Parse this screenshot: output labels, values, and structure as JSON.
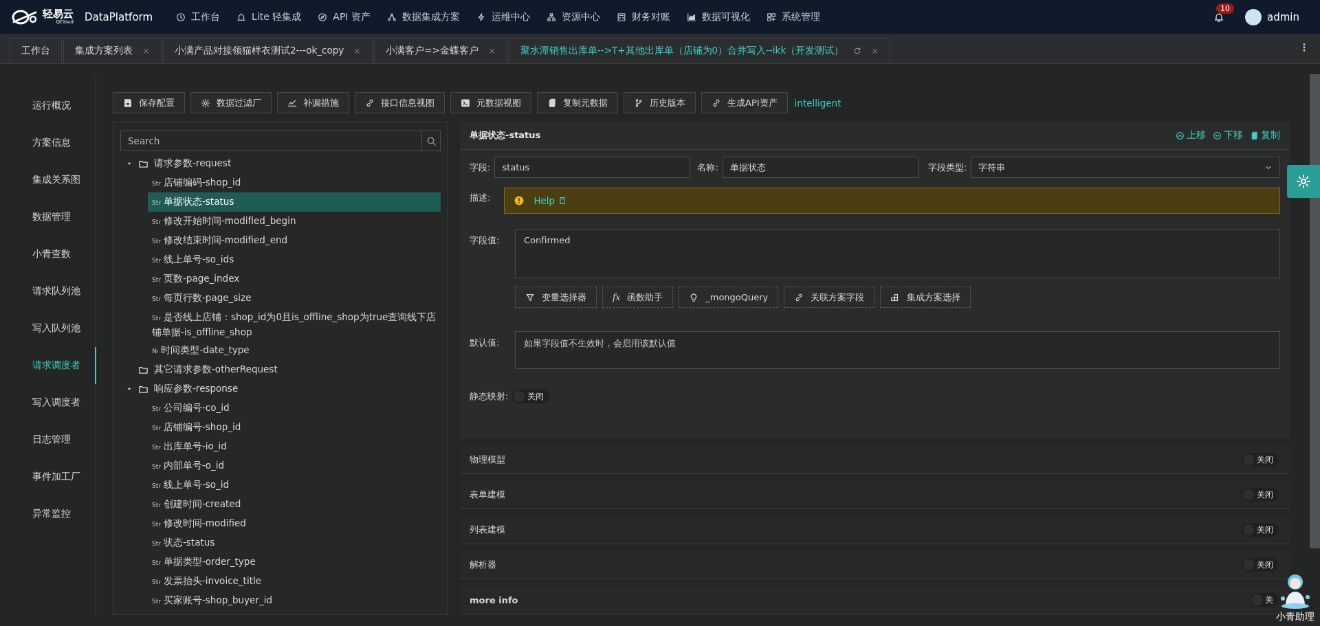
{
  "nav": {
    "brand": "轻易云",
    "brand_sub": "QCloud",
    "product": "DataPlatform",
    "menu": [
      {
        "label": "工作台"
      },
      {
        "label": "Lite 轻集成"
      },
      {
        "label": "API 资产"
      },
      {
        "label": "数据集成方案"
      },
      {
        "label": "运维中心"
      },
      {
        "label": "资源中心"
      },
      {
        "label": "财务对账"
      },
      {
        "label": "数据可视化"
      },
      {
        "label": "系统管理"
      }
    ],
    "notifications": "10",
    "user": "admin"
  },
  "tabs": [
    {
      "label": "工作台",
      "selected": false,
      "closable": false
    },
    {
      "label": "集成方案列表",
      "selected": false,
      "closable": true
    },
    {
      "label": "小满产品对接领猫样衣测试2---ok_copy",
      "selected": false,
      "closable": true
    },
    {
      "label": "小满客户=>金蝶客户",
      "selected": false,
      "closable": true
    },
    {
      "label": "聚水潭销售出库单-->T+其他出库单（店铺为0）合并写入--ikk（开发测试）",
      "selected": true,
      "closable": true
    }
  ],
  "sidebar": {
    "items": [
      {
        "label": "运行概况",
        "selected": false
      },
      {
        "label": "方案信息",
        "selected": false
      },
      {
        "label": "集成关系图",
        "selected": false
      },
      {
        "label": "数据管理",
        "selected": false
      },
      {
        "label": "小青查数",
        "selected": false
      },
      {
        "label": "请求队列池",
        "selected": false
      },
      {
        "label": "写入队列池",
        "selected": false
      },
      {
        "label": "请求调度者",
        "selected": true
      },
      {
        "label": "写入调度者",
        "selected": false
      },
      {
        "label": "日志管理",
        "selected": false
      },
      {
        "label": "事件加工厂",
        "selected": false
      },
      {
        "label": "异常监控",
        "selected": false
      }
    ]
  },
  "toolbar": {
    "buttons": [
      {
        "label": "保存配置"
      },
      {
        "label": "数据过滤厂"
      },
      {
        "label": "补漏措施"
      },
      {
        "label": "接口信息视图"
      },
      {
        "label": "元数据视图"
      },
      {
        "label": "复制元数据"
      },
      {
        "label": "历史版本"
      },
      {
        "label": "生成API资产"
      }
    ],
    "link": "intelligent"
  },
  "tree": {
    "search": {
      "placeholder": "Search"
    },
    "nodes": [
      {
        "kind": "folder",
        "label": "请求参数-request",
        "expanded": true,
        "children": [
          {
            "kind": "field",
            "type_tag": "Str",
            "label": "店铺编码-shop_id",
            "selected": false
          },
          {
            "kind": "field",
            "type_tag": "Str",
            "label": "单据状态-status",
            "selected": true
          },
          {
            "kind": "field",
            "type_tag": "Str",
            "label": "修改开始时间-modified_begin",
            "selected": false
          },
          {
            "kind": "field",
            "type_tag": "Str",
            "label": "修改结束时间-modified_end",
            "selected": false
          },
          {
            "kind": "field",
            "type_tag": "Str",
            "label": "线上单号-so_ids",
            "selected": false
          },
          {
            "kind": "field",
            "type_tag": "Str",
            "label": "页数-page_index",
            "selected": false
          },
          {
            "kind": "field",
            "type_tag": "Str",
            "label": "每页行数-page_size",
            "selected": false
          },
          {
            "kind": "field",
            "type_tag": "Str",
            "label": "是否线上店铺：shop_id为0且is_offline_shop为true查询线下店铺单据-is_offline_shop",
            "selected": false
          },
          {
            "kind": "field",
            "type_tag": "№",
            "label": "时间类型-date_type",
            "selected": false
          }
        ]
      },
      {
        "kind": "folder",
        "label": "其它请求参数-otherRequest",
        "expanded": false
      },
      {
        "kind": "folder",
        "label": "响应参数-response",
        "expanded": true,
        "children": [
          {
            "kind": "field",
            "type_tag": "Str",
            "label": "公司编号-co_id",
            "selected": false
          },
          {
            "kind": "field",
            "type_tag": "Str",
            "label": "店铺编号-shop_id",
            "selected": false
          },
          {
            "kind": "field",
            "type_tag": "Str",
            "label": "出库单号-io_id",
            "selected": false
          },
          {
            "kind": "field",
            "type_tag": "Str",
            "label": "内部单号-o_id",
            "selected": false
          },
          {
            "kind": "field",
            "type_tag": "Str",
            "label": "线上单号-so_id",
            "selected": false
          },
          {
            "kind": "field",
            "type_tag": "Str",
            "label": "创建时间-created",
            "selected": false
          },
          {
            "kind": "field",
            "type_tag": "Str",
            "label": "修改时间-modified",
            "selected": false
          },
          {
            "kind": "field",
            "type_tag": "Str",
            "label": "状态-status",
            "selected": false
          },
          {
            "kind": "field",
            "type_tag": "Str",
            "label": "单据类型-order_type",
            "selected": false
          },
          {
            "kind": "field",
            "type_tag": "Str",
            "label": "发票抬头-invoice_title",
            "selected": false
          },
          {
            "kind": "field",
            "type_tag": "Str",
            "label": "买家账号-shop_buyer_id",
            "selected": false
          }
        ]
      }
    ]
  },
  "detail": {
    "title": "单据状态-status",
    "actions": [
      {
        "label": "上移"
      },
      {
        "label": "下移"
      },
      {
        "label": "复制"
      }
    ],
    "field_label": "字段:",
    "field_value": "status",
    "name_label": "名称:",
    "name_value": "单据状态",
    "type_label": "字段类型:",
    "type_value": "字符串",
    "desc_label": "描述:",
    "help": "Help",
    "value_label": "字段值:",
    "value": "Confirmed",
    "helpers": [
      {
        "label": "变量选择器"
      },
      {
        "label": "函数助手",
        "icon_text": "fx"
      },
      {
        "label": "_mongoQuery"
      },
      {
        "label": "关联方案字段"
      },
      {
        "label": "集成方案选择"
      }
    ],
    "default_label": "默认值:",
    "default_placeholder": "如果字段值不生效时，会启用该默认值",
    "mapping_label": "静态映射:",
    "mapping": {
      "on": false,
      "label": "关闭"
    }
  },
  "sections": [
    {
      "title": "物理模型",
      "on": false,
      "toggle_label": "关闭"
    },
    {
      "title": "表单建模",
      "on": false,
      "toggle_label": "关闭"
    },
    {
      "title": "列表建模",
      "on": false,
      "toggle_label": "关闭"
    },
    {
      "title": "解析器",
      "on": false,
      "toggle_label": "关闭"
    },
    {
      "title": "more info",
      "on": false,
      "toggle_label": "关"
    }
  ],
  "assistant": {
    "label": "小青助理"
  }
}
